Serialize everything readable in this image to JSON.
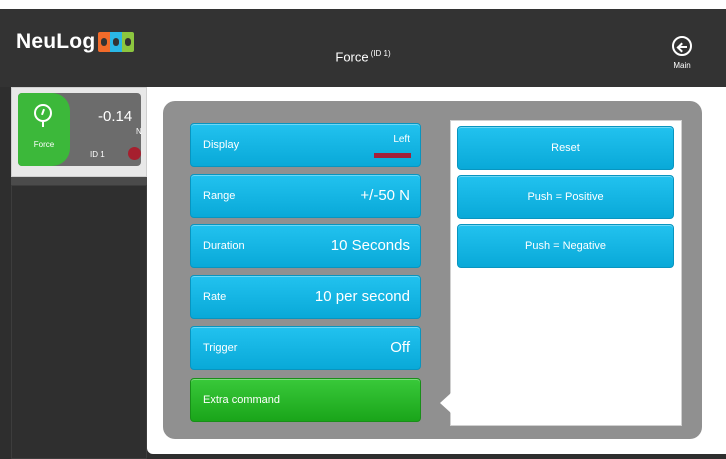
{
  "app": {
    "logo_text": "NeuLog",
    "title": "Force",
    "title_sup": "(ID 1)",
    "main_label": "Main"
  },
  "sensor": {
    "name": "Force",
    "value": "-0.14",
    "unit": "N",
    "id_label": "ID 1",
    "record_color": "#a61f2e"
  },
  "settings": [
    {
      "label": "Display",
      "value": "Left"
    },
    {
      "label": "Range",
      "value": "+/-50 N"
    },
    {
      "label": "Duration",
      "value": "10 Seconds"
    },
    {
      "label": "Rate",
      "value": "10 per second"
    },
    {
      "label": "Trigger",
      "value": "Off"
    },
    {
      "label": "Extra command",
      "value": ""
    }
  ],
  "commands": [
    "Reset",
    "Push = Positive",
    "Push = Negative"
  ],
  "colors": {
    "accent": "#16b3e2",
    "active": "#2bb52a",
    "display_swatch": "#a3213a",
    "header": "#333333"
  }
}
